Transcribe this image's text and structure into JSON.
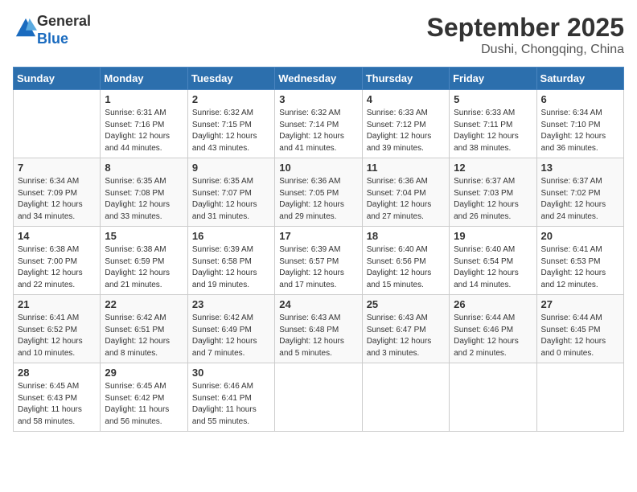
{
  "header": {
    "logo": {
      "general": "General",
      "blue": "Blue"
    },
    "month": "September 2025",
    "location": "Dushi, Chongqing, China"
  },
  "weekdays": [
    "Sunday",
    "Monday",
    "Tuesday",
    "Wednesday",
    "Thursday",
    "Friday",
    "Saturday"
  ],
  "weeks": [
    [
      {
        "day": "",
        "info": ""
      },
      {
        "day": "1",
        "info": "Sunrise: 6:31 AM\nSunset: 7:16 PM\nDaylight: 12 hours\nand 44 minutes."
      },
      {
        "day": "2",
        "info": "Sunrise: 6:32 AM\nSunset: 7:15 PM\nDaylight: 12 hours\nand 43 minutes."
      },
      {
        "day": "3",
        "info": "Sunrise: 6:32 AM\nSunset: 7:14 PM\nDaylight: 12 hours\nand 41 minutes."
      },
      {
        "day": "4",
        "info": "Sunrise: 6:33 AM\nSunset: 7:12 PM\nDaylight: 12 hours\nand 39 minutes."
      },
      {
        "day": "5",
        "info": "Sunrise: 6:33 AM\nSunset: 7:11 PM\nDaylight: 12 hours\nand 38 minutes."
      },
      {
        "day": "6",
        "info": "Sunrise: 6:34 AM\nSunset: 7:10 PM\nDaylight: 12 hours\nand 36 minutes."
      }
    ],
    [
      {
        "day": "7",
        "info": "Sunrise: 6:34 AM\nSunset: 7:09 PM\nDaylight: 12 hours\nand 34 minutes."
      },
      {
        "day": "8",
        "info": "Sunrise: 6:35 AM\nSunset: 7:08 PM\nDaylight: 12 hours\nand 33 minutes."
      },
      {
        "day": "9",
        "info": "Sunrise: 6:35 AM\nSunset: 7:07 PM\nDaylight: 12 hours\nand 31 minutes."
      },
      {
        "day": "10",
        "info": "Sunrise: 6:36 AM\nSunset: 7:05 PM\nDaylight: 12 hours\nand 29 minutes."
      },
      {
        "day": "11",
        "info": "Sunrise: 6:36 AM\nSunset: 7:04 PM\nDaylight: 12 hours\nand 27 minutes."
      },
      {
        "day": "12",
        "info": "Sunrise: 6:37 AM\nSunset: 7:03 PM\nDaylight: 12 hours\nand 26 minutes."
      },
      {
        "day": "13",
        "info": "Sunrise: 6:37 AM\nSunset: 7:02 PM\nDaylight: 12 hours\nand 24 minutes."
      }
    ],
    [
      {
        "day": "14",
        "info": "Sunrise: 6:38 AM\nSunset: 7:00 PM\nDaylight: 12 hours\nand 22 minutes."
      },
      {
        "day": "15",
        "info": "Sunrise: 6:38 AM\nSunset: 6:59 PM\nDaylight: 12 hours\nand 21 minutes."
      },
      {
        "day": "16",
        "info": "Sunrise: 6:39 AM\nSunset: 6:58 PM\nDaylight: 12 hours\nand 19 minutes."
      },
      {
        "day": "17",
        "info": "Sunrise: 6:39 AM\nSunset: 6:57 PM\nDaylight: 12 hours\nand 17 minutes."
      },
      {
        "day": "18",
        "info": "Sunrise: 6:40 AM\nSunset: 6:56 PM\nDaylight: 12 hours\nand 15 minutes."
      },
      {
        "day": "19",
        "info": "Sunrise: 6:40 AM\nSunset: 6:54 PM\nDaylight: 12 hours\nand 14 minutes."
      },
      {
        "day": "20",
        "info": "Sunrise: 6:41 AM\nSunset: 6:53 PM\nDaylight: 12 hours\nand 12 minutes."
      }
    ],
    [
      {
        "day": "21",
        "info": "Sunrise: 6:41 AM\nSunset: 6:52 PM\nDaylight: 12 hours\nand 10 minutes."
      },
      {
        "day": "22",
        "info": "Sunrise: 6:42 AM\nSunset: 6:51 PM\nDaylight: 12 hours\nand 8 minutes."
      },
      {
        "day": "23",
        "info": "Sunrise: 6:42 AM\nSunset: 6:49 PM\nDaylight: 12 hours\nand 7 minutes."
      },
      {
        "day": "24",
        "info": "Sunrise: 6:43 AM\nSunset: 6:48 PM\nDaylight: 12 hours\nand 5 minutes."
      },
      {
        "day": "25",
        "info": "Sunrise: 6:43 AM\nSunset: 6:47 PM\nDaylight: 12 hours\nand 3 minutes."
      },
      {
        "day": "26",
        "info": "Sunrise: 6:44 AM\nSunset: 6:46 PM\nDaylight: 12 hours\nand 2 minutes."
      },
      {
        "day": "27",
        "info": "Sunrise: 6:44 AM\nSunset: 6:45 PM\nDaylight: 12 hours\nand 0 minutes."
      }
    ],
    [
      {
        "day": "28",
        "info": "Sunrise: 6:45 AM\nSunset: 6:43 PM\nDaylight: 11 hours\nand 58 minutes."
      },
      {
        "day": "29",
        "info": "Sunrise: 6:45 AM\nSunset: 6:42 PM\nDaylight: 11 hours\nand 56 minutes."
      },
      {
        "day": "30",
        "info": "Sunrise: 6:46 AM\nSunset: 6:41 PM\nDaylight: 11 hours\nand 55 minutes."
      },
      {
        "day": "",
        "info": ""
      },
      {
        "day": "",
        "info": ""
      },
      {
        "day": "",
        "info": ""
      },
      {
        "day": "",
        "info": ""
      }
    ]
  ]
}
